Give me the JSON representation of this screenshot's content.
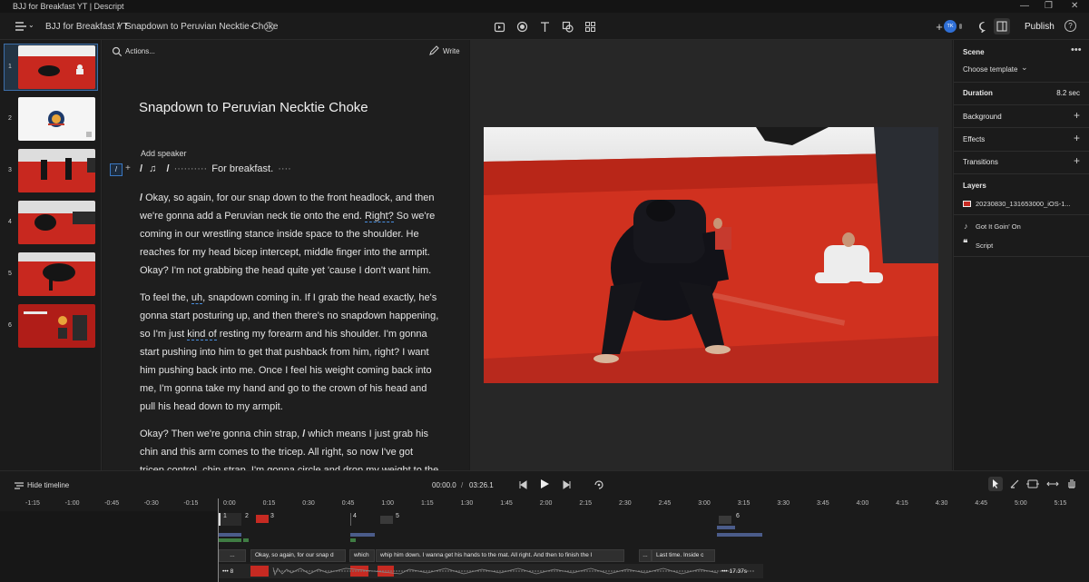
{
  "window": {
    "title": "BJJ for Breakfast YT | Descript"
  },
  "topbar": {
    "project": "BJJ for Breakfast YT",
    "separator": "/",
    "composition": "Snapdown to Peruvian Necktie Choke",
    "avatar": "TK",
    "publish": "Publish",
    "help": "?"
  },
  "scenes": [
    {
      "num": "1"
    },
    {
      "num": "2"
    },
    {
      "num": "3"
    },
    {
      "num": "4"
    },
    {
      "num": "5"
    },
    {
      "num": "6"
    }
  ],
  "script": {
    "search": "Actions...",
    "write": "Write",
    "title": "Snapdown to Peruvian Necktie Choke",
    "add_speaker": "Add speaker",
    "gutter_slash": "/",
    "gutter_plus": "+",
    "first_line": {
      "slash1": "/",
      "note": "♫",
      "slash2": "/",
      "dots": "··········",
      "text": "For breakfast.",
      "dots2": "····"
    },
    "para1": {
      "slash": "/",
      "a": " Okay, so again, for our snap down to the front headlock, and then we're gonna add a Peruvian neck tie onto the end. ",
      "right": "Right?",
      "b": " So we're coming in our wrestling stance inside space to the shoulder. He reaches for my head bicep intercept, middle finger into the armpit. Okay? I'm not grabbing the head quite yet 'cause I don't want him."
    },
    "para2": {
      "a": "To feel the, ",
      "uh": "uh",
      "b": ", snapdown coming in. If I grab the head exactly, he's gonna start posturing up, and then there's no snapdown happening, so I'm just ",
      "kind": "kind of",
      "c": " resting my forearm and his shoulder. I'm gonna start pushing into him to get that pushback from him, right? I want him pushing back into me. Once I feel his weight coming back into me, I'm gonna take my hand and go to the crown of his head and pull his head down to my armpit."
    },
    "para3": {
      "a": "Okay? Then we're gonna chin strap, ",
      "slash": "/",
      "b": " which means I just grab his chin and this arm comes to the tricep. All right, so now I've got tricep control, chin strap. I'm gonna circle and drop my weight to the"
    }
  },
  "props": {
    "scene": "Scene",
    "choose_template": "Choose template",
    "duration_label": "Duration",
    "duration_value": "8.2 sec",
    "background": "Background",
    "effects": "Effects",
    "transitions": "Transitions",
    "layers": "Layers",
    "layer_items": [
      {
        "label": "20230830_131653000_iOS-1..."
      },
      {
        "label": "Got It Goin' On"
      },
      {
        "label": "Script"
      }
    ]
  },
  "timeline": {
    "hide_label": "Hide timeline",
    "current": "00:00.0",
    "sep": "/",
    "total": "03:26.1",
    "ticks": [
      "-1:15",
      "-1:00",
      "-0:45",
      "-0:30",
      "-0:15",
      "0:00",
      "0:15",
      "0:30",
      "0:45",
      "1:00",
      "1:15",
      "1:30",
      "1:45",
      "2:00",
      "2:15",
      "2:30",
      "2:45",
      "3:00",
      "3:15",
      "3:30",
      "3:45",
      "4:00",
      "4:15",
      "4:30",
      "4:45",
      "5:00",
      "5:15"
    ],
    "scenes": [
      "1",
      "2",
      "3",
      "4",
      "5",
      "6"
    ],
    "captions": [
      {
        "text": "..."
      },
      {
        "text": "Okay, so again, for our snap d"
      },
      {
        "text": "which"
      },
      {
        "text": "whip him down. I wanna get his hands to the mat. All right. And then to finish the l"
      },
      {
        "text": "..."
      },
      {
        "text": "Last time. Inside c"
      }
    ],
    "bottom_left": "••• 8",
    "bottom_right": "••• 17.37s"
  },
  "colors": {
    "accent": "#3b82f6",
    "mat": "#c62a22",
    "bg": "#1b1b1b"
  }
}
